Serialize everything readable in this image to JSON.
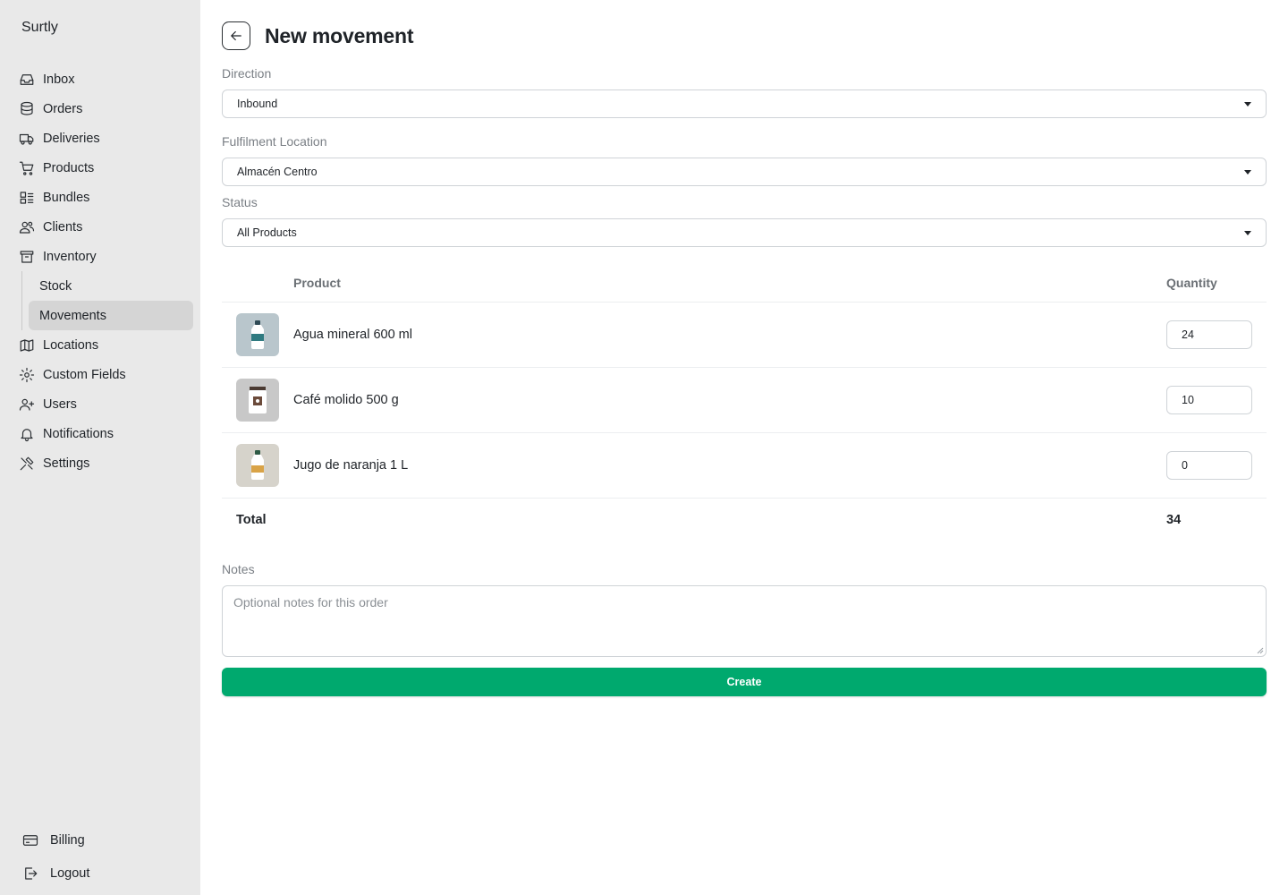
{
  "app": {
    "name": "Surtly"
  },
  "sidebar": {
    "items": [
      {
        "label": "Inbox",
        "icon": "inbox-icon"
      },
      {
        "label": "Orders",
        "icon": "database-icon"
      },
      {
        "label": "Deliveries",
        "icon": "truck-icon"
      },
      {
        "label": "Products",
        "icon": "cart-icon"
      },
      {
        "label": "Bundles",
        "icon": "bundles-icon"
      },
      {
        "label": "Clients",
        "icon": "users-icon"
      },
      {
        "label": "Inventory",
        "icon": "archive-icon"
      }
    ],
    "sub_items": [
      {
        "label": "Stock",
        "active": false
      },
      {
        "label": "Movements",
        "active": true
      }
    ],
    "items_after": [
      {
        "label": "Locations",
        "icon": "map-icon"
      },
      {
        "label": "Custom Fields",
        "icon": "cog-icon"
      },
      {
        "label": "Users",
        "icon": "user-plus-icon"
      },
      {
        "label": "Notifications",
        "icon": "bell-icon"
      },
      {
        "label": "Settings",
        "icon": "tools-icon"
      }
    ],
    "bottom": [
      {
        "label": "Billing",
        "icon": "credit-card-icon"
      },
      {
        "label": "Logout",
        "icon": "logout-icon"
      }
    ]
  },
  "header": {
    "title": "New movement"
  },
  "form": {
    "direction": {
      "label": "Direction",
      "value": "Inbound"
    },
    "location": {
      "label": "Fulfilment Location",
      "value": "Almacén Centro"
    },
    "status": {
      "label": "Status",
      "value": "All Products"
    }
  },
  "table": {
    "columns": {
      "product": "Product",
      "quantity": "Quantity"
    },
    "rows": [
      {
        "name": "Agua mineral 600 ml",
        "quantity": "24",
        "thumb_bg": "#b9c6cc",
        "label_color": "#2f7a80"
      },
      {
        "name": "Café molido 500 g",
        "quantity": "10",
        "thumb_bg": "#c8c8c8",
        "label_color": "#6b4a3a"
      },
      {
        "name": "Jugo de naranja 1 L",
        "quantity": "0",
        "thumb_bg": "#d6d3cb",
        "label_color": "#d9a347"
      }
    ],
    "total_label": "Total",
    "total_value": "34"
  },
  "notes": {
    "label": "Notes",
    "placeholder": "Optional notes for this order"
  },
  "actions": {
    "create_label": "Create"
  },
  "colors": {
    "accent": "#00a96e",
    "sidebar_bg": "#e9e9e9",
    "active_item_bg": "#d5d5d5"
  }
}
